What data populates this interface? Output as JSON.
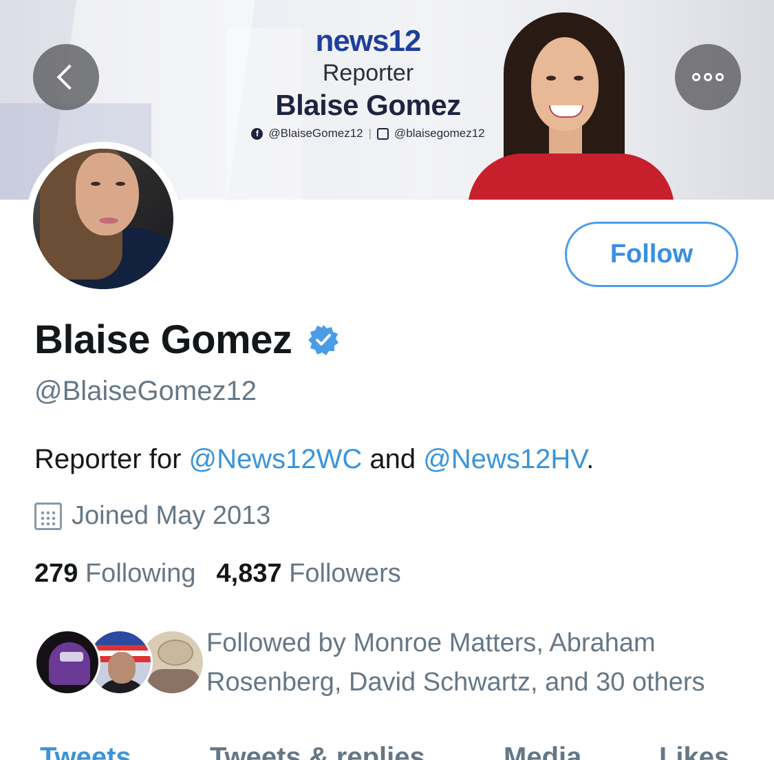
{
  "banner": {
    "brand_logo": "news12",
    "role": "Reporter",
    "name": "Blaise Gomez",
    "facebook_handle": "@BlaiseGomez12",
    "instagram_handle": "@blaisegomez12"
  },
  "nav": {
    "back_icon": "chevron-left-icon",
    "more_icon": "more-options-icon"
  },
  "profile": {
    "display_name": "Blaise Gomez",
    "verified": true,
    "handle": "@BlaiseGomez12",
    "bio": {
      "prefix": "Reporter for ",
      "mention1": "@News12WC",
      "middle": " and ",
      "mention2": "@News12HV",
      "suffix": "."
    },
    "joined": "Joined May 2013",
    "following_count": "279",
    "following_label": "Following",
    "followers_count": "4,837",
    "followers_label": "Followers",
    "followed_by": "Followed by Monroe Matters, Abraham Rosenberg, David Schwartz, and 30 others"
  },
  "follow_button": {
    "label": "Follow"
  },
  "tabs": [
    {
      "label": "Tweets",
      "active": true
    },
    {
      "label": "Tweets & replies",
      "active": false
    },
    {
      "label": "Media",
      "active": false
    },
    {
      "label": "Likes",
      "active": false
    }
  ],
  "colors": {
    "accent": "#3b94d9",
    "secondary_text": "#657786",
    "primary_text": "#14171a",
    "verified_badge": "#4a9be8"
  }
}
